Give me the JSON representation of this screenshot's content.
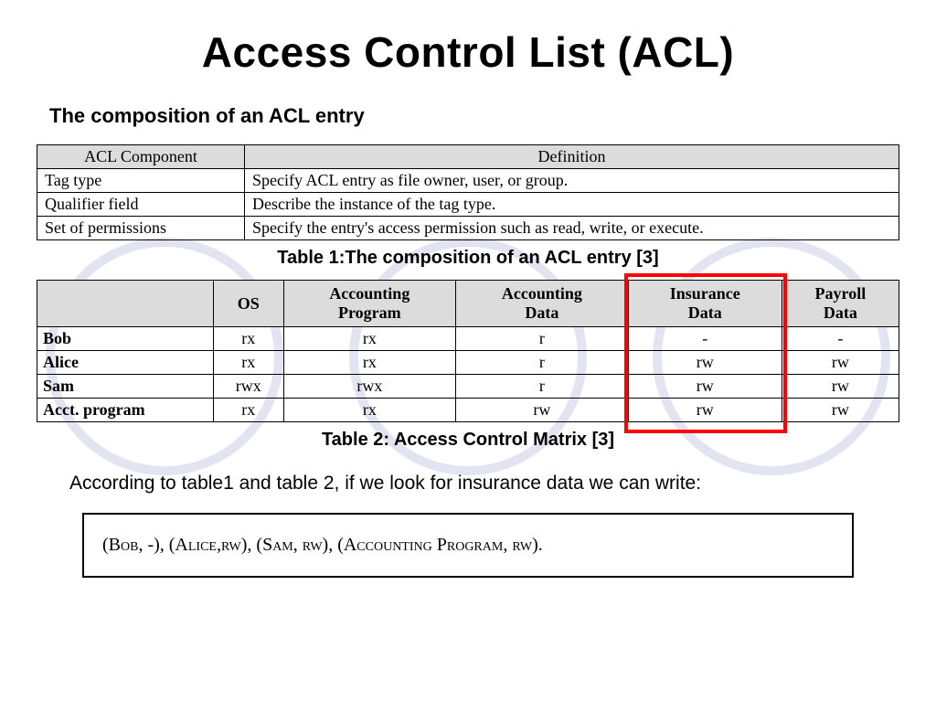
{
  "title": "Access Control List (ACL)",
  "subheading": "The composition of an ACL entry",
  "definition_table": {
    "headers": [
      "ACL Component",
      "Definition"
    ],
    "rows": [
      {
        "comp": "Tag type",
        "def": "Specify ACL entry as file owner, user, or group."
      },
      {
        "comp": "Qualifier field",
        "def": "Describe the instance of the tag type."
      },
      {
        "comp": "Set of permissions",
        "def": "Specify the entry's access permission such as read, write, or execute."
      }
    ]
  },
  "caption1": "Table 1:The composition of an ACL entry [3]",
  "matrix_table": {
    "headers": [
      "",
      "OS",
      "Accounting Program",
      "Accounting Data",
      "Insurance Data",
      "Payroll Data"
    ],
    "rows": [
      {
        "name": "Bob",
        "cells": [
          "rx",
          "rx",
          "r",
          "-",
          "-"
        ]
      },
      {
        "name": "Alice",
        "cells": [
          "rx",
          "rx",
          "r",
          "rw",
          "rw"
        ]
      },
      {
        "name": "Sam",
        "cells": [
          "rwx",
          "rwx",
          "r",
          "rw",
          "rw"
        ]
      },
      {
        "name": "Acct. program",
        "cells": [
          "rx",
          "rx",
          "rw",
          "rw",
          "rw"
        ]
      }
    ],
    "highlight_column": "Insurance Data"
  },
  "caption2": "Table 2: Access Control Matrix [3]",
  "body_text": "According to table1 and table 2, if we look for insurance data we can write:",
  "tuples": "(Bob, -), (Alice,rw), (Sam, rw), (Accounting Program, rw)."
}
